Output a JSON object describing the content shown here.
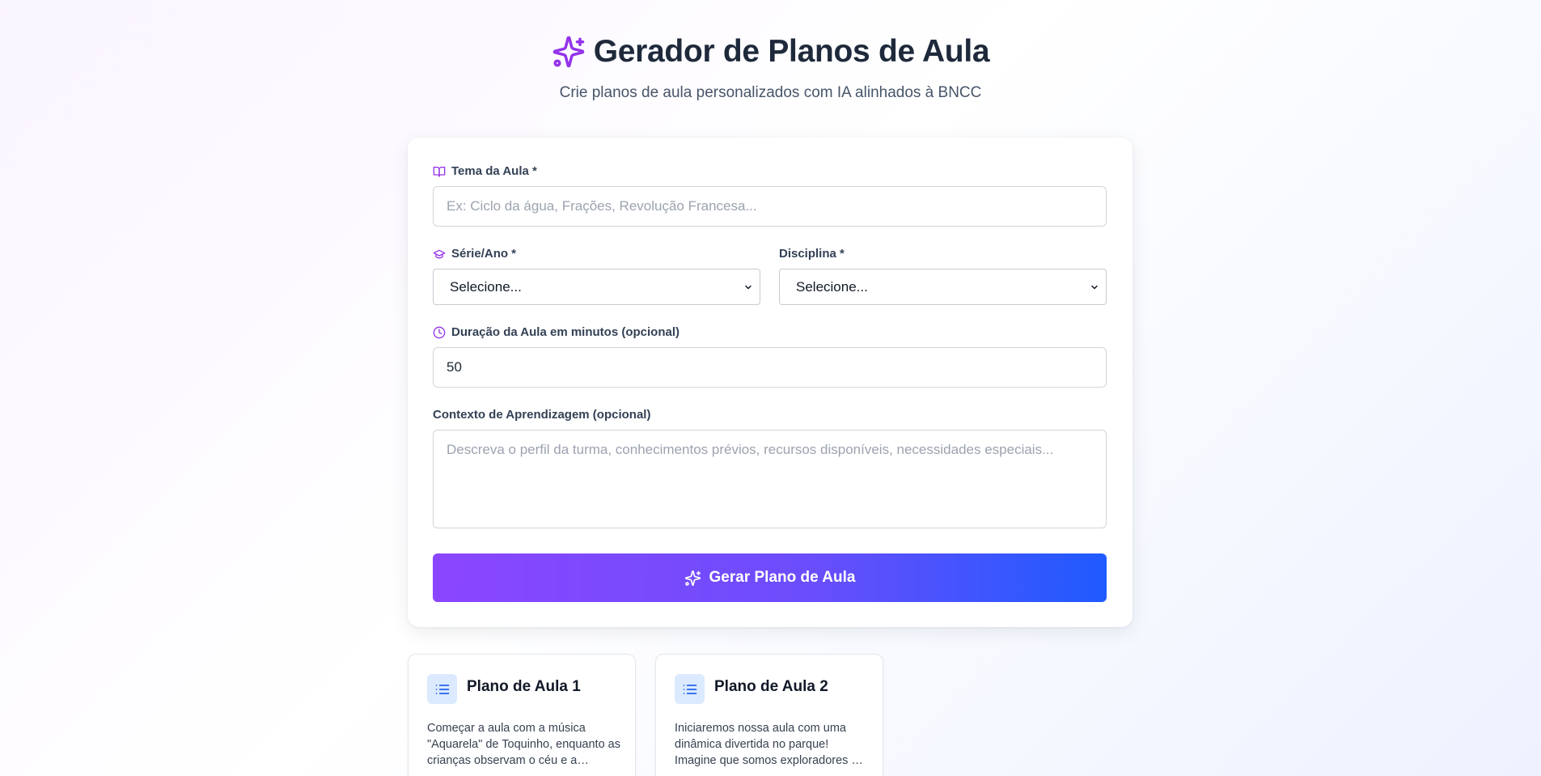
{
  "header": {
    "title": "Gerador de Planos de Aula",
    "subtitle": "Crie planos de aula personalizados com IA alinhados à BNCC",
    "icon": "sparkles-icon",
    "accent_color": "#9333ea"
  },
  "form": {
    "tema": {
      "label": "Tema da Aula *",
      "placeholder": "Ex: Ciclo da água, Frações, Revolução Francesa...",
      "value": ""
    },
    "serie": {
      "label": "Série/Ano *",
      "selected": "Selecione..."
    },
    "disciplina": {
      "label": "Disciplina *",
      "selected": "Selecione..."
    },
    "duracao": {
      "label": "Duração da Aula em minutos (opcional)",
      "value": "50"
    },
    "contexto": {
      "label": "Contexto de Aprendizagem (opcional)",
      "placeholder": "Descreva o perfil da turma, conhecimentos prévios, recursos disponíveis, necessidades especiais...",
      "value": ""
    },
    "submit_label": "Gerar Plano de Aula",
    "submit_gradient": [
      "#8b46ff",
      "#1e5bff"
    ]
  },
  "plans": [
    {
      "title": "Plano de Aula 1",
      "description": "Começar a aula com a música \"Aquarela\" de Toquinho, enquanto as crianças observam o céu e a…"
    },
    {
      "title": "Plano de Aula 2",
      "description": "Iniciaremos nossa aula com uma dinâmica divertida no parque! Imagine que somos exploradores …"
    }
  ]
}
